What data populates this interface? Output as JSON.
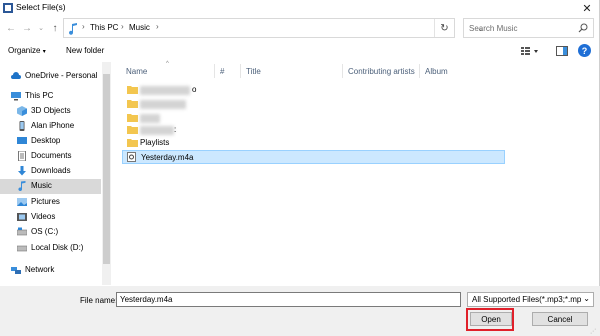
{
  "window": {
    "title": "Select File(s)"
  },
  "address": {
    "crumbs": [
      "This PC",
      "Music"
    ],
    "search_placeholder": "Search Music"
  },
  "toolbar": {
    "organize_label": "Organize",
    "new_folder_label": "New folder"
  },
  "nav": {
    "items": [
      {
        "label": "OneDrive - Personal",
        "icon": "cloud-icon"
      },
      {
        "label": "This PC",
        "icon": "computer-icon"
      },
      {
        "label": "3D Objects",
        "icon": "cube-icon"
      },
      {
        "label": "Alan iPhone",
        "icon": "phone-icon"
      },
      {
        "label": "Desktop",
        "icon": "desktop-icon"
      },
      {
        "label": "Documents",
        "icon": "document-icon"
      },
      {
        "label": "Downloads",
        "icon": "download-icon"
      },
      {
        "label": "Music",
        "icon": "music-icon",
        "selected": true
      },
      {
        "label": "Pictures",
        "icon": "picture-icon"
      },
      {
        "label": "Videos",
        "icon": "video-icon"
      },
      {
        "label": "OS (C:)",
        "icon": "drive-icon"
      },
      {
        "label": "Local Disk (D:)",
        "icon": "drive-icon"
      },
      {
        "label": "Network",
        "icon": "network-icon"
      }
    ]
  },
  "columns": {
    "name": "Name",
    "number": "#",
    "title": "Title",
    "artists": "Contributing artists",
    "album": "Album"
  },
  "files": [
    {
      "label": "",
      "type": "folder",
      "blurred": true,
      "tail": "o"
    },
    {
      "label": "",
      "type": "folder",
      "blurred": true,
      "tail": ""
    },
    {
      "label": "",
      "type": "folder",
      "blurred": true,
      "tail": ""
    },
    {
      "label": "",
      "type": "folder",
      "blurred": true,
      "tail": ":"
    },
    {
      "label": "Playlists",
      "type": "folder"
    },
    {
      "label": "Yesterday.m4a",
      "type": "audio",
      "selected": true
    }
  ],
  "footer": {
    "file_name_label": "File name:",
    "file_name_value": "Yesterday.m4a",
    "filter_value": "All Supported Files(*.mp3;*.mp",
    "open_label": "Open",
    "cancel_label": "Cancel"
  },
  "colors": {
    "accent": "#1f6fd6",
    "selection": "#cce8ff",
    "highlight": "#e0202a"
  }
}
